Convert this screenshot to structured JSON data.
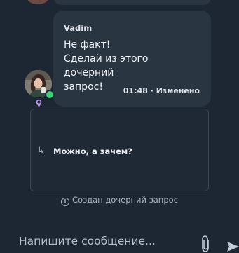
{
  "message": {
    "author": "Vadim",
    "lines": [
      "Не факт!",
      "Сделай из этого дочерний",
      "запрос!"
    ],
    "time": "01:48",
    "edited": "Изменено",
    "meta": "01:48 · Изменено"
  },
  "thread": {
    "reply_text": "Можно, а зачем?"
  },
  "system": {
    "text": "Создан дочерний запрос"
  },
  "composer": {
    "placeholder": "Напишите сообщение...",
    "value": ""
  },
  "icons": {
    "attach": "paperclip-icon",
    "send": "send-icon",
    "info": "info-icon",
    "reply": "reply-arrow-icon",
    "role": "mentor-badge-icon"
  },
  "colors": {
    "background": "#1d2733",
    "bubble": "#2a3542",
    "online": "#3ecf74",
    "role_badge": "#c79bf2"
  }
}
